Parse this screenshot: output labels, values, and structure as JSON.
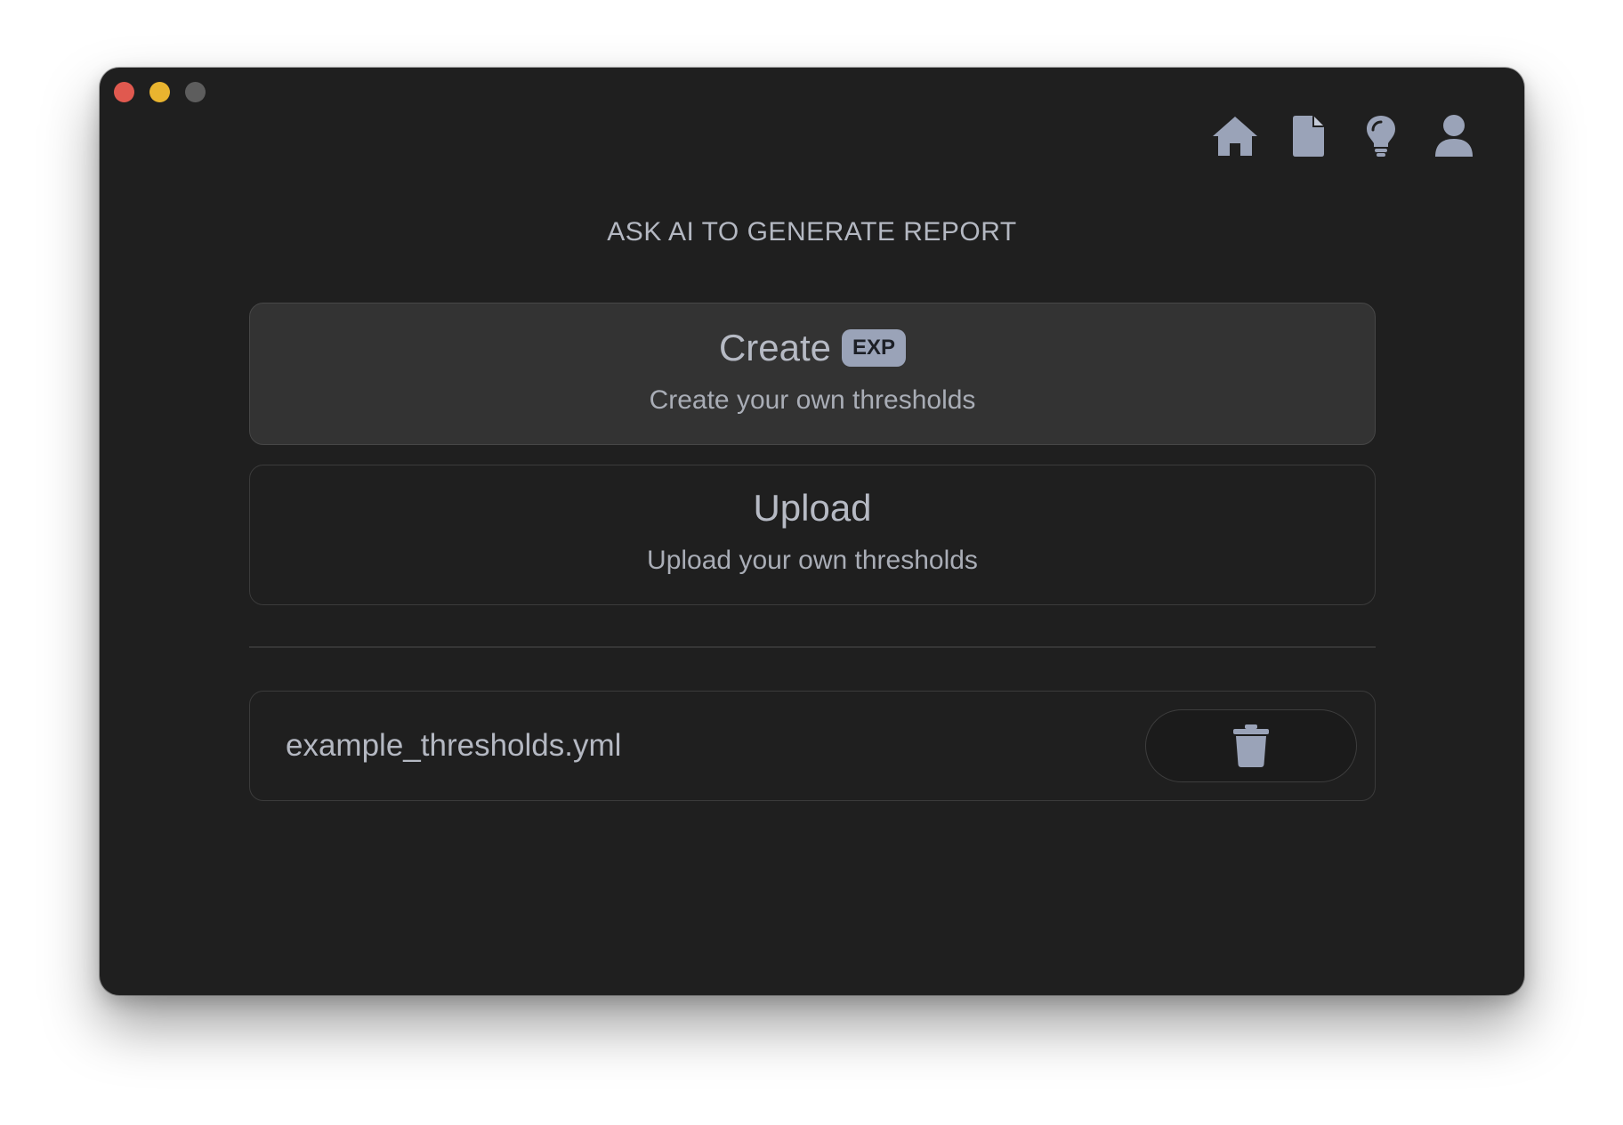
{
  "window": {
    "traffic_lights": [
      {
        "name": "close",
        "color": "#e0594f"
      },
      {
        "name": "minimize",
        "color": "#e9b42f"
      },
      {
        "name": "maximize",
        "color": "#5d5d5d"
      }
    ]
  },
  "nav": {
    "icons": [
      "home-icon",
      "document-icon",
      "lightbulb-icon",
      "user-icon"
    ],
    "icon_color": "#9aa3b8"
  },
  "main": {
    "heading": "ASK AI TO GENERATE REPORT",
    "options": [
      {
        "title": "Create",
        "badge": "EXP",
        "subtitle": "Create your own thresholds"
      },
      {
        "title": "Upload",
        "subtitle": "Upload your own thresholds"
      }
    ],
    "files": [
      {
        "name": "example_thresholds.yml",
        "action_icon": "trash-icon"
      }
    ]
  },
  "colors": {
    "window_bg": "#1f1f1f",
    "selected_card_bg": "#333333",
    "text": "#b4b8c2",
    "accent_icon": "#9aa3b8"
  }
}
